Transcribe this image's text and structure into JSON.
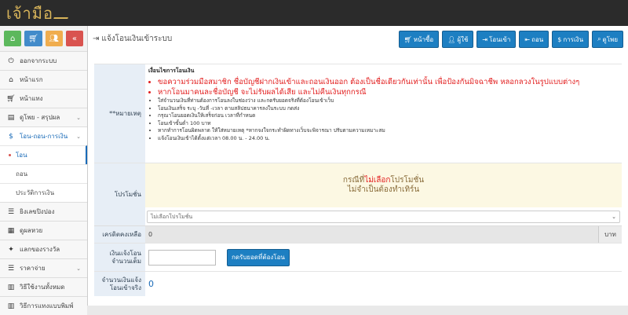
{
  "app": {
    "logo_text": "เจ้ามือ"
  },
  "colors": {
    "primary": "#1d7fc2",
    "notice_red": "#e21d1d",
    "promo_bg": "#fcf8e3"
  },
  "shortcuts": [
    {
      "icon": "home-icon",
      "color": "#5cb85c"
    },
    {
      "icon": "cart-icon",
      "color": "#428bca"
    },
    {
      "icon": "users-icon",
      "color": "#f0ad4e"
    },
    {
      "icon": "double-chevron-left-icon",
      "color": "#d9534f"
    }
  ],
  "sidebar": {
    "logout": "ออกจากระบบ",
    "home": "หน้าแรก",
    "collect": "หน้าแทง",
    "view_bets": "ดูโพย - สรุปผล",
    "transfer": "โอน-ถอน-การเงิน",
    "sub": {
      "deposit": "โอน",
      "withdraw": "ถอน",
      "history": "ประวัติการเงิน"
    },
    "coupon": "ยิงเลขปิงปอง",
    "lottery": "ดูผลหวย",
    "rewards": "แลกของรางวัล",
    "rates": "ราคาจ่าย",
    "how_to_all": "วิธีใช้งานทั้งหมด",
    "how_to_print": "วิธีการแทงแบบพิมพ์"
  },
  "page": {
    "title": "แจ้งโอนเงินเข้าระบบ"
  },
  "top_buttons": {
    "home": "หน้าซื้อ",
    "user": "ผู้ใช้",
    "deposit": "โอนเข้า",
    "withdraw": "ถอน",
    "finance": "การเงิน",
    "bets": "ดูโพย"
  },
  "form": {
    "remark_label": "**หมายเหตุ",
    "notice_title": "เงื่อนไขการโอนเงิน",
    "notices": [
      "ขอความร่วมมือสมาชิก ชื่อบัญชีฝากเงินเข้าและถอนเงินออก ต้องเป็นชื่อเดียวกันเท่านั้น เพื่อป้องกันมิจฉาชีพ หลอกลวงในรูปแบบต่างๆ",
      "หากโอนมาคนละชื่อบัญชี จะไม่รับผลได้เสีย และไม่คืนเงินทุกกรณี",
      "ใส่จำนวนเงินที่ท่านต้องการโอนลงในช่องว่าง และกดรับยอดจริงที่ต้องโอนเข้าเว็บ",
      "โอนเงินเสร็จ ระบุ -วันที่ -เวลา ตามสลิปธนาคารลงในระบบ กดส่ง",
      "กรุณาโอนยอดเงินให้เสร็จก่อน เวลาที่กำหนด",
      "โอนเข้าขั้นต่ำ 100 บาท",
      "หากทำการโอนผิดพลาด ให้ใส่หมายเหตุ *หากจงใจกระทำผิดทางเว็บจะพิจารณา ปรับตามความเหมาะสม",
      "แจ้งโอนเงินเข้าได้ตั้งแต่เวลา 08.00 น. - 24.00 น."
    ],
    "promo_label": "โปรโมชั่น",
    "promo_line1_pre": "กรณีที่",
    "promo_line1_hl": "ไม่เลือก",
    "promo_line1_post": "โปรโมชั่น",
    "promo_line2": "ไม่จำเป็นต้องทำเทิร์น",
    "promo_select": "ไม่เลือกโปรโมชั่น",
    "credit_label": "เครดิตคงเหลือ",
    "credit_value": "0",
    "credit_unit": "บาท",
    "amount_label": "เงินแจ้งโอน จำนวนเต็ม",
    "calc_button": "กดรับยอดที่ต้องโอน",
    "real_label": "จำนวนเงินแจ้ง โอนเข้าจริง",
    "real_value": "0"
  }
}
